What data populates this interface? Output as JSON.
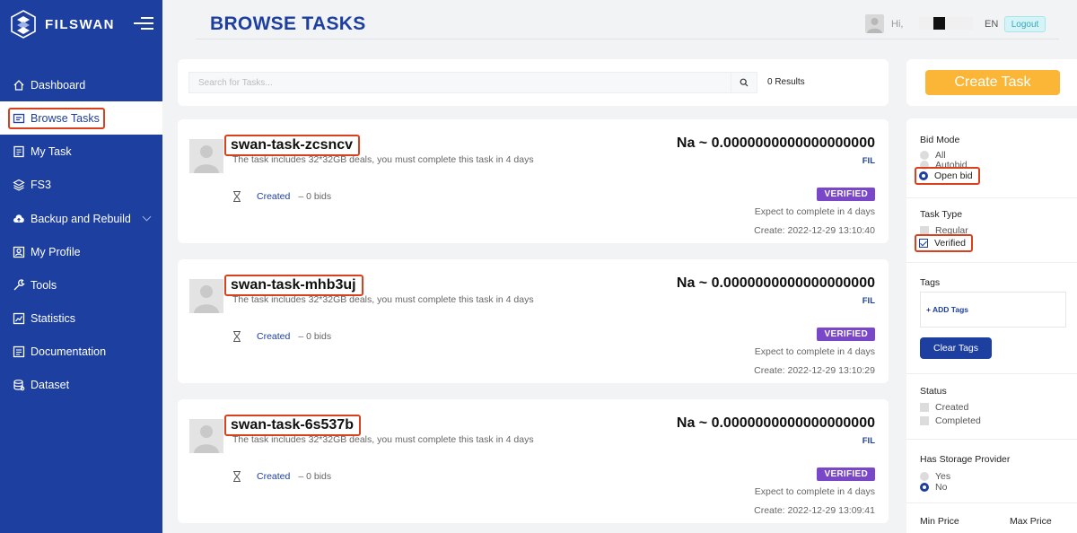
{
  "sidebar": {
    "brand": "FILSWAN",
    "items": [
      {
        "label": "Dashboard",
        "icon": "home-icon"
      },
      {
        "label": "Browse Tasks",
        "icon": "browse-icon"
      },
      {
        "label": "My Task",
        "icon": "task-icon"
      },
      {
        "label": "FS3",
        "icon": "storage-icon"
      },
      {
        "label": "Backup and Rebuild",
        "icon": "cloud-icon"
      },
      {
        "label": "My Profile",
        "icon": "profile-icon"
      },
      {
        "label": "Tools",
        "icon": "tools-icon"
      },
      {
        "label": "Statistics",
        "icon": "statistics-icon"
      },
      {
        "label": "Documentation",
        "icon": "document-icon"
      },
      {
        "label": "Dataset",
        "icon": "dataset-icon"
      }
    ]
  },
  "header": {
    "title": "BROWSE TASKS",
    "greeting": "Hi,",
    "language": "EN",
    "logout_label": "Logout"
  },
  "search": {
    "placeholder": "Search for Tasks...",
    "results": "0 Results"
  },
  "tasks": [
    {
      "name": "swan-task-zcsncv",
      "description": "The task includes 32*32GB deals, you must complete this task in 4 days",
      "status": "Created",
      "bids": "– 0 bids",
      "price": "Na ~ 0.0000000000000000000",
      "currency": "FIL",
      "badge": "VERIFIED",
      "expect": "Expect to complete in 4 days",
      "created_at": "Create: 2022-12-29 13:10:40"
    },
    {
      "name": "swan-task-mhb3uj",
      "description": "The task includes 32*32GB deals, you must complete this task in 4 days",
      "status": "Created",
      "bids": "– 0 bids",
      "price": "Na ~ 0.0000000000000000000",
      "currency": "FIL",
      "badge": "VERIFIED",
      "expect": "Expect to complete in 4 days",
      "created_at": "Create: 2022-12-29 13:10:29"
    },
    {
      "name": "swan-task-6s537b",
      "description": "The task includes 32*32GB deals, you must complete this task in 4 days",
      "status": "Created",
      "bids": "– 0 bids",
      "price": "Na ~ 0.0000000000000000000",
      "currency": "FIL",
      "badge": "VERIFIED",
      "expect": "Expect to complete in 4 days",
      "created_at": "Create: 2022-12-29 13:09:41"
    }
  ],
  "filters": {
    "create_label": "Create Task",
    "bid_mode": {
      "title": "Bid Mode",
      "options": [
        "All",
        "Autobid",
        "Open bid"
      ],
      "selected": "Open bid"
    },
    "task_type": {
      "title": "Task Type",
      "options": [
        "Regular",
        "Verified"
      ],
      "checked": "Verified"
    },
    "tags": {
      "title": "Tags",
      "add_label": "+ ADD Tags",
      "clear_label": "Clear Tags"
    },
    "status": {
      "title": "Status",
      "options": [
        "Created",
        "Completed"
      ]
    },
    "storage_provider": {
      "title": "Has Storage Provider",
      "options": [
        "Yes",
        "No"
      ],
      "selected": "No"
    },
    "min_price": "Min Price",
    "max_price": "Max Price"
  },
  "colors": {
    "primary": "#1d3fa0",
    "accent": "#fbb637",
    "badge": "#7a47c8",
    "highlight": "#d9401e"
  }
}
